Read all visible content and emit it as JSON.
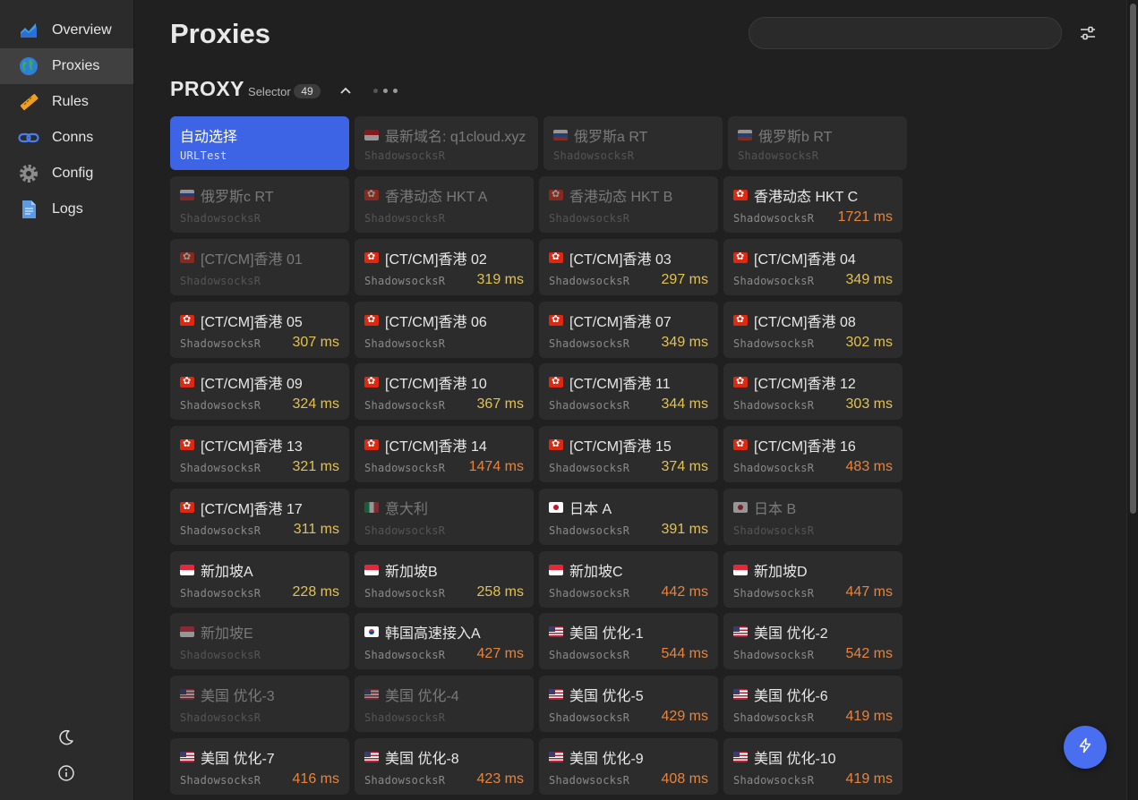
{
  "sidebar": {
    "items": [
      {
        "label": "Overview",
        "icon": "chart-area-icon"
      },
      {
        "label": "Proxies",
        "icon": "globe-icon"
      },
      {
        "label": "Rules",
        "icon": "ruler-icon"
      },
      {
        "label": "Conns",
        "icon": "link-icon"
      },
      {
        "label": "Config",
        "icon": "gear-icon"
      },
      {
        "label": "Logs",
        "icon": "document-icon"
      }
    ],
    "active": "Proxies",
    "bottom": [
      "moon-icon",
      "info-icon"
    ]
  },
  "header": {
    "title": "Proxies",
    "search": {
      "value": "",
      "placeholder": ""
    }
  },
  "group": {
    "name": "PROXY",
    "type": "Selector",
    "count": "49"
  },
  "colors": {
    "accent": "#3e64e6",
    "latency_good": "#e3c24f",
    "latency_warn": "#e6843e"
  },
  "proxies": [
    {
      "name": "自动选择",
      "type": "URLTest",
      "latency": "",
      "flag": "",
      "state": "selected"
    },
    {
      "name": "最新域名: q1cloud.xyz",
      "type": "ShadowsocksR",
      "latency": "",
      "flag": "id",
      "state": "dim"
    },
    {
      "name": "俄罗斯a RT",
      "type": "ShadowsocksR",
      "latency": "",
      "flag": "ru",
      "state": "dim"
    },
    {
      "name": "俄罗斯b RT",
      "type": "ShadowsocksR",
      "latency": "",
      "flag": "ru",
      "state": "dim"
    },
    {
      "name": "俄罗斯c RT",
      "type": "ShadowsocksR",
      "latency": "",
      "flag": "ru",
      "state": "dim"
    },
    {
      "name": "香港动态 HKT A",
      "type": "ShadowsocksR",
      "latency": "",
      "flag": "hk",
      "state": "dim"
    },
    {
      "name": "香港动态 HKT B",
      "type": "ShadowsocksR",
      "latency": "",
      "flag": "hk",
      "state": "dim"
    },
    {
      "name": "香港动态 HKT C",
      "type": "ShadowsocksR",
      "latency": "1721 ms",
      "flag": "hk",
      "state": "warn"
    },
    {
      "name": "[CT/CM]香港 01",
      "type": "ShadowsocksR",
      "latency": "",
      "flag": "hk",
      "state": "dim"
    },
    {
      "name": "[CT/CM]香港 02",
      "type": "ShadowsocksR",
      "latency": "319 ms",
      "flag": "hk",
      "state": "good"
    },
    {
      "name": "[CT/CM]香港 03",
      "type": "ShadowsocksR",
      "latency": "297 ms",
      "flag": "hk",
      "state": "good"
    },
    {
      "name": "[CT/CM]香港 04",
      "type": "ShadowsocksR",
      "latency": "349 ms",
      "flag": "hk",
      "state": "good"
    },
    {
      "name": "[CT/CM]香港 05",
      "type": "ShadowsocksR",
      "latency": "307 ms",
      "flag": "hk",
      "state": "good"
    },
    {
      "name": "[CT/CM]香港 06",
      "type": "ShadowsocksR",
      "latency": "",
      "flag": "hk",
      "state": "normal"
    },
    {
      "name": "[CT/CM]香港 07",
      "type": "ShadowsocksR",
      "latency": "349 ms",
      "flag": "hk",
      "state": "good"
    },
    {
      "name": "[CT/CM]香港 08",
      "type": "ShadowsocksR",
      "latency": "302 ms",
      "flag": "hk",
      "state": "good"
    },
    {
      "name": "[CT/CM]香港 09",
      "type": "ShadowsocksR",
      "latency": "324 ms",
      "flag": "hk",
      "state": "good"
    },
    {
      "name": "[CT/CM]香港 10",
      "type": "ShadowsocksR",
      "latency": "367 ms",
      "flag": "hk",
      "state": "good"
    },
    {
      "name": "[CT/CM]香港 11",
      "type": "ShadowsocksR",
      "latency": "344 ms",
      "flag": "hk",
      "state": "good"
    },
    {
      "name": "[CT/CM]香港 12",
      "type": "ShadowsocksR",
      "latency": "303 ms",
      "flag": "hk",
      "state": "good"
    },
    {
      "name": "[CT/CM]香港 13",
      "type": "ShadowsocksR",
      "latency": "321 ms",
      "flag": "hk",
      "state": "good"
    },
    {
      "name": "[CT/CM]香港 14",
      "type": "ShadowsocksR",
      "latency": "1474 ms",
      "flag": "hk",
      "state": "warn"
    },
    {
      "name": "[CT/CM]香港 15",
      "type": "ShadowsocksR",
      "latency": "374 ms",
      "flag": "hk",
      "state": "good"
    },
    {
      "name": "[CT/CM]香港 16",
      "type": "ShadowsocksR",
      "latency": "483 ms",
      "flag": "hk",
      "state": "warn"
    },
    {
      "name": "[CT/CM]香港 17",
      "type": "ShadowsocksR",
      "latency": "311 ms",
      "flag": "hk",
      "state": "good"
    },
    {
      "name": "意大利",
      "type": "ShadowsocksR",
      "latency": "",
      "flag": "it",
      "state": "dim"
    },
    {
      "name": "日本 A",
      "type": "ShadowsocksR",
      "latency": "391 ms",
      "flag": "jp",
      "state": "good"
    },
    {
      "name": "日本 B",
      "type": "ShadowsocksR",
      "latency": "",
      "flag": "jp",
      "state": "dim"
    },
    {
      "name": "新加坡A",
      "type": "ShadowsocksR",
      "latency": "228 ms",
      "flag": "sg",
      "state": "good"
    },
    {
      "name": "新加坡B",
      "type": "ShadowsocksR",
      "latency": "258 ms",
      "flag": "sg",
      "state": "good"
    },
    {
      "name": "新加坡C",
      "type": "ShadowsocksR",
      "latency": "442 ms",
      "flag": "sg",
      "state": "warn"
    },
    {
      "name": "新加坡D",
      "type": "ShadowsocksR",
      "latency": "447 ms",
      "flag": "sg",
      "state": "warn"
    },
    {
      "name": "新加坡E",
      "type": "ShadowsocksR",
      "latency": "",
      "flag": "sg",
      "state": "dim"
    },
    {
      "name": "韩国高速接入A",
      "type": "ShadowsocksR",
      "latency": "427 ms",
      "flag": "kr",
      "state": "warn"
    },
    {
      "name": "美国 优化-1",
      "type": "ShadowsocksR",
      "latency": "544 ms",
      "flag": "us",
      "state": "warn"
    },
    {
      "name": "美国 优化-2",
      "type": "ShadowsocksR",
      "latency": "542 ms",
      "flag": "us",
      "state": "warn"
    },
    {
      "name": "美国 优化-3",
      "type": "ShadowsocksR",
      "latency": "",
      "flag": "us",
      "state": "dim"
    },
    {
      "name": "美国 优化-4",
      "type": "ShadowsocksR",
      "latency": "",
      "flag": "us",
      "state": "dim"
    },
    {
      "name": "美国 优化-5",
      "type": "ShadowsocksR",
      "latency": "429 ms",
      "flag": "us",
      "state": "warn"
    },
    {
      "name": "美国 优化-6",
      "type": "ShadowsocksR",
      "latency": "419 ms",
      "flag": "us",
      "state": "warn"
    },
    {
      "name": "美国 优化-7",
      "type": "ShadowsocksR",
      "latency": "416 ms",
      "flag": "us",
      "state": "warn"
    },
    {
      "name": "美国 优化-8",
      "type": "ShadowsocksR",
      "latency": "423 ms",
      "flag": "us",
      "state": "warn"
    },
    {
      "name": "美国 优化-9",
      "type": "ShadowsocksR",
      "latency": "408 ms",
      "flag": "us",
      "state": "warn"
    },
    {
      "name": "美国 优化-10",
      "type": "ShadowsocksR",
      "latency": "419 ms",
      "flag": "us",
      "state": "warn"
    }
  ]
}
